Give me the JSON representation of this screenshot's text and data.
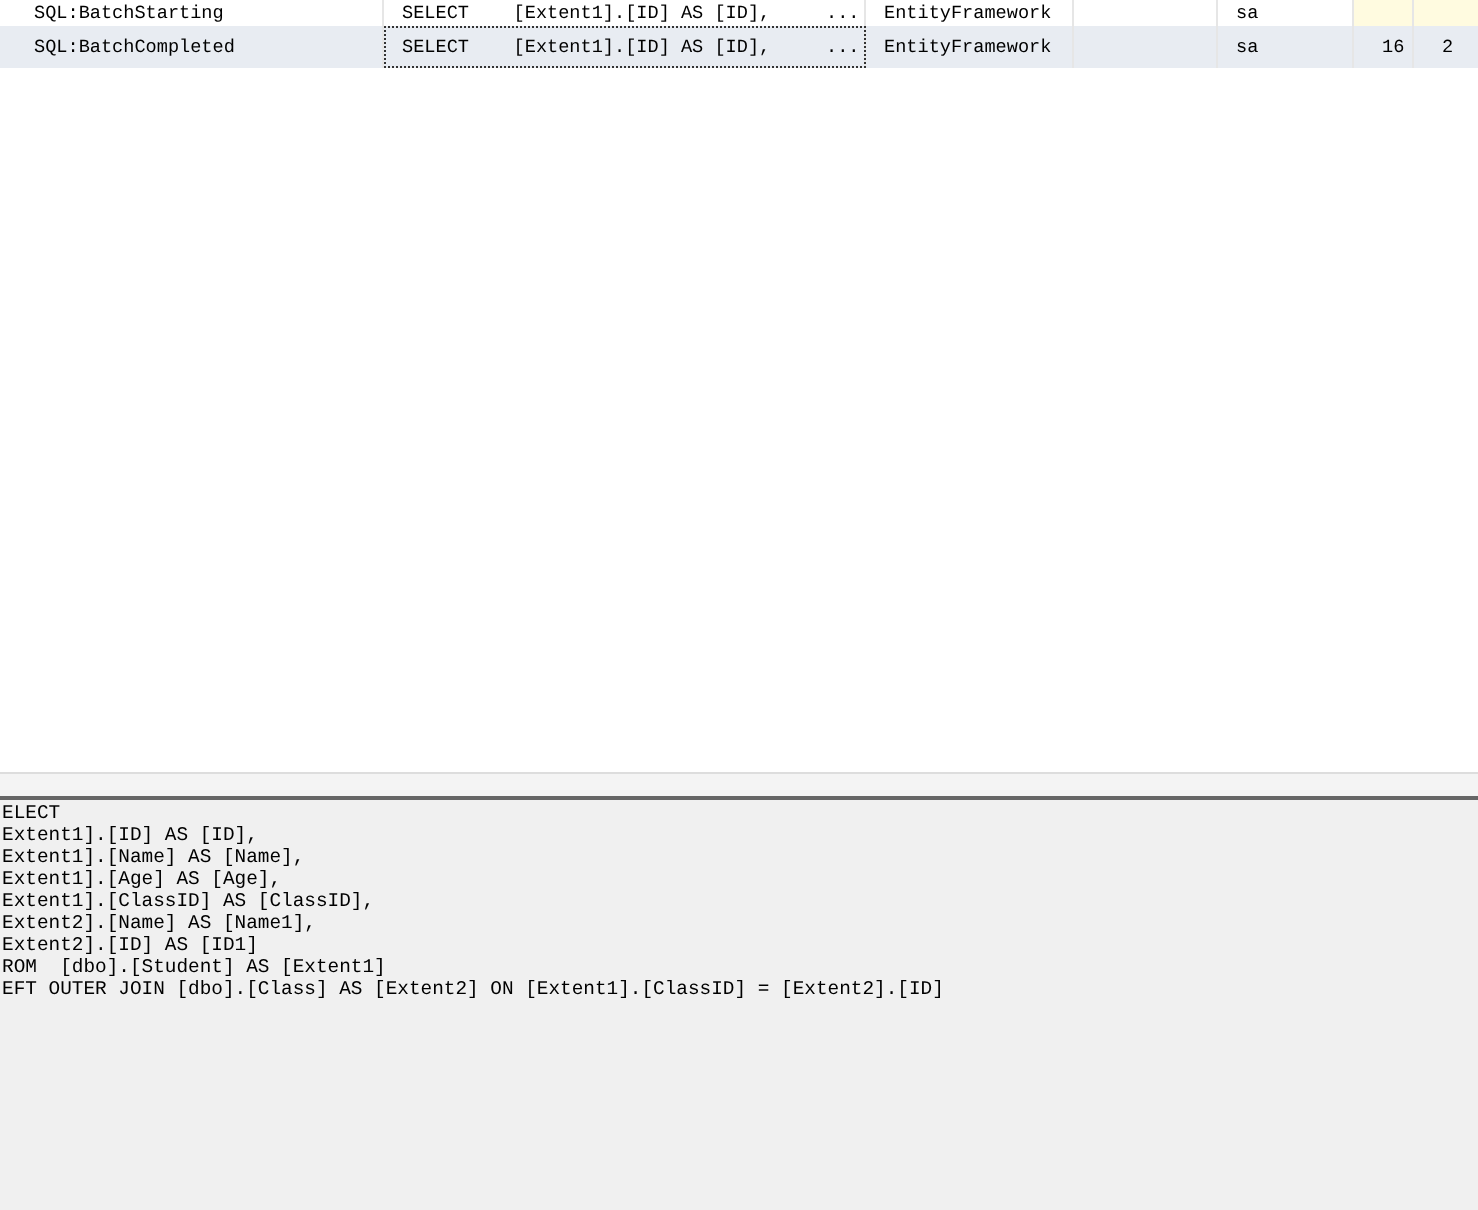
{
  "trace_table": {
    "rows": [
      {
        "selected": false,
        "cells": [
          {
            "text": "SQL:BatchStarting",
            "shaded": false,
            "focused": false
          },
          {
            "text": "SELECT    [Extent1].[ID] AS [ID],     ...",
            "shaded": false,
            "focused": false
          },
          {
            "text": "EntityFramework",
            "shaded": false,
            "focused": false
          },
          {
            "shaded": false,
            "focused": false
          },
          {
            "text": "sa",
            "shaded": false,
            "focused": false
          },
          {
            "shaded": true,
            "focused": false
          },
          {
            "shaded": true,
            "focused": false
          }
        ]
      },
      {
        "selected": true,
        "cells": [
          {
            "text": "SQL:BatchCompleted",
            "shaded": false,
            "focused": false
          },
          {
            "text": "SELECT    [Extent1].[ID] AS [ID],     ...",
            "shaded": false,
            "focused": true
          },
          {
            "text": "EntityFramework",
            "shaded": false,
            "focused": false
          },
          {
            "shaded": false,
            "focused": false
          },
          {
            "text": "sa",
            "shaded": false,
            "focused": false
          },
          {
            "text": "16",
            "shaded": false,
            "focused": false
          },
          {
            "text": "2",
            "shaded": false,
            "focused": false
          }
        ]
      }
    ]
  },
  "detail_pane": {
    "lines": [
      "ELECT",
      "Extent1].[ID] AS [ID],",
      "Extent1].[Name] AS [Name],",
      "Extent1].[Age] AS [Age],",
      "Extent1].[ClassID] AS [ClassID],",
      "Extent2].[Name] AS [Name1],",
      "Extent2].[ID] AS [ID1]",
      "ROM  [dbo].[Student] AS [Extent1]",
      "EFT OUTER JOIN [dbo].[Class] AS [Extent2] ON [Extent1].[ClassID] = [Extent2].[ID]"
    ]
  }
}
